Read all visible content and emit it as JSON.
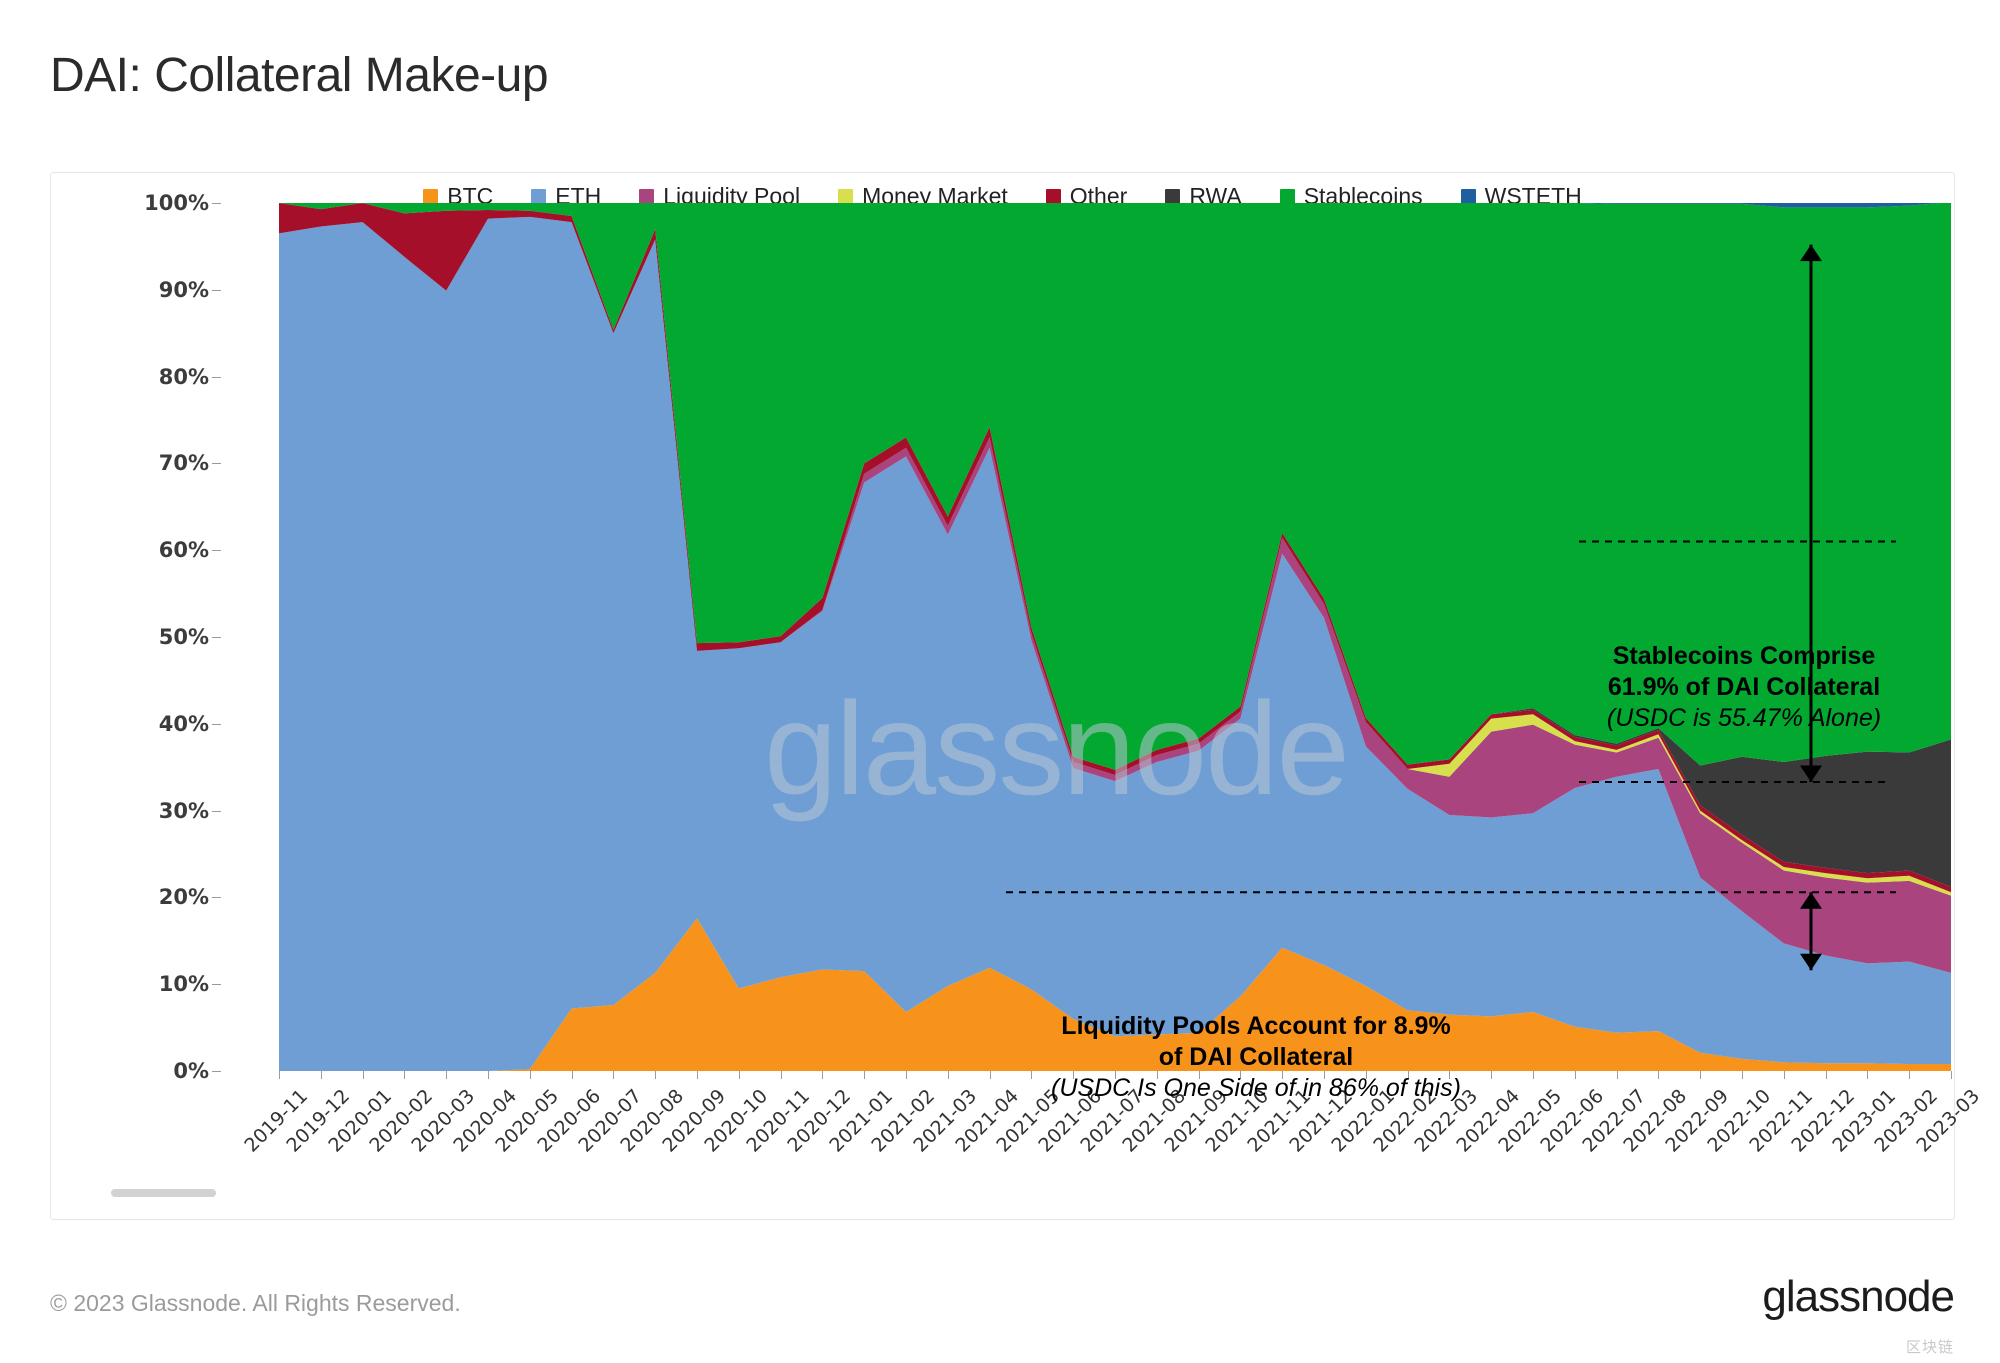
{
  "page_title": "DAI: Collateral Make-up",
  "footer": {
    "copyright": "© 2023 Glassnode. All Rights Reserved.",
    "logo": "glassnode",
    "corner_mark": "区块链"
  },
  "watermark": "glassnode",
  "annotations": {
    "stablecoins": {
      "line1": "Stablecoins Comprise",
      "line2": "61.9% of DAI Collateral",
      "line3": "(USDC is 55.47% Alone)"
    },
    "liquidity_pools": {
      "line1": "Liquidity Pools Account for 8.9%",
      "line2": "of DAI Collateral",
      "line3": "(USDC Is One Side of in 86% of this)"
    }
  },
  "chart_data": {
    "type": "area",
    "stacked": true,
    "title": "DAI: Collateral Make-up",
    "xlabel": "",
    "ylabel": "",
    "ylim": [
      0,
      100
    ],
    "ytick_labels": [
      "0%",
      "10%",
      "20%",
      "30%",
      "40%",
      "50%",
      "60%",
      "70%",
      "80%",
      "90%",
      "100%"
    ],
    "ytick_values": [
      0,
      10,
      20,
      30,
      40,
      50,
      60,
      70,
      80,
      90,
      100
    ],
    "grid": false,
    "legend_position": "top-center",
    "categories": [
      "2019-11",
      "2019-12",
      "2020-01",
      "2020-02",
      "2020-03",
      "2020-04",
      "2020-05",
      "2020-06",
      "2020-07",
      "2020-08",
      "2020-09",
      "2020-10",
      "2020-11",
      "2020-12",
      "2021-01",
      "2021-02",
      "2021-03",
      "2021-04",
      "2021-05",
      "2021-06",
      "2021-07",
      "2021-08",
      "2021-09",
      "2021-10",
      "2021-11",
      "2021-12",
      "2022-01",
      "2022-02",
      "2022-03",
      "2022-04",
      "2022-05",
      "2022-06",
      "2022-07",
      "2022-08",
      "2022-09",
      "2022-10",
      "2022-11",
      "2022-12",
      "2023-01",
      "2023-02",
      "2023-03"
    ],
    "series": [
      {
        "name": "BTC",
        "color": "#F7931A",
        "values": [
          0,
          0,
          0,
          0,
          0,
          0,
          0.2,
          7.2,
          7.6,
          11.3,
          17.6,
          9.5,
          10.8,
          11.7,
          11.5,
          6.8,
          9.8,
          11.9,
          9.4,
          6.0,
          4.0,
          4.2,
          4.4,
          8.6,
          14.2,
          12.2,
          9.8,
          7.0,
          6.5,
          6.3,
          6.8,
          5.1,
          4.4,
          4.6,
          2.1,
          1.4,
          1.0,
          0.9,
          0.9,
          0.8,
          0.8
        ]
      },
      {
        "name": "ETH",
        "color": "#6E9ED4",
        "values": [
          96.5,
          97.3,
          97.8,
          93.8,
          89.9,
          98.2,
          98.2,
          90.6,
          77.4,
          84.5,
          30.8,
          39.2,
          38.6,
          41.3,
          56.3,
          64.0,
          52.0,
          59.9,
          40.2,
          28.9,
          29.4,
          31.4,
          32.5,
          32.0,
          45.4,
          40.0,
          27.6,
          25.5,
          23.0,
          22.9,
          22.9,
          27.5,
          29.5,
          30.2,
          20.2,
          17.0,
          13.7,
          12.4,
          11.5,
          11.8,
          10.5
        ]
      },
      {
        "name": "Liquidity Pool",
        "color": "#A9447F",
        "values": [
          0,
          0,
          0,
          0,
          0,
          0,
          0,
          0,
          0,
          0,
          0,
          0,
          0,
          0.1,
          1.0,
          1.0,
          1.0,
          1.2,
          0.8,
          0.7,
          0.7,
          0.8,
          0.8,
          0.8,
          1.8,
          1.6,
          2.8,
          2.3,
          4.4,
          9.9,
          10.2,
          5.0,
          2.8,
          3.6,
          7.4,
          7.9,
          8.4,
          9.0,
          9.3,
          9.3,
          8.9
        ]
      },
      {
        "name": "Money Market",
        "color": "#D7E04C",
        "values": [
          0,
          0,
          0,
          0,
          0,
          0,
          0,
          0,
          0,
          0,
          0,
          0,
          0,
          0,
          0,
          0,
          0,
          0,
          0,
          0,
          0,
          0,
          0,
          0,
          0,
          0,
          0,
          0,
          1.5,
          1.5,
          1.2,
          0.4,
          0.3,
          0.4,
          0.3,
          0.3,
          0.4,
          0.5,
          0.5,
          0.6,
          0.4
        ]
      },
      {
        "name": "Other",
        "color": "#A50F2A",
        "values": [
          3.5,
          2.0,
          2.2,
          5.0,
          9.2,
          1.0,
          0.7,
          0.7,
          0.4,
          1.2,
          0.9,
          0.7,
          0.7,
          1.4,
          1.2,
          1.2,
          1.1,
          1.2,
          0.7,
          0.6,
          0.6,
          0.6,
          0.6,
          0.6,
          0.6,
          0.6,
          0.5,
          0.5,
          0.5,
          0.5,
          0.5,
          0.5,
          0.5,
          0.5,
          0.6,
          0.6,
          0.6,
          0.6,
          0.6,
          0.6,
          0.6
        ]
      },
      {
        "name": "RWA",
        "color": "#3A3A3A",
        "values": [
          0,
          0,
          0,
          0,
          0,
          0,
          0,
          0,
          0,
          0,
          0,
          0,
          0,
          0,
          0,
          0,
          0,
          0,
          0,
          0,
          0,
          0,
          0,
          0,
          0,
          0,
          0,
          0,
          0,
          0,
          0.2,
          0.2,
          0.2,
          0.2,
          4.6,
          9.0,
          11.5,
          12.9,
          14.0,
          13.6,
          17.0
        ]
      },
      {
        "name": "Stablecoins",
        "color": "#02A82F",
        "values": [
          0,
          0.7,
          0,
          1.2,
          0.9,
          0.8,
          0.9,
          1.5,
          14.6,
          3.0,
          50.7,
          50.6,
          49.9,
          45.5,
          30.0,
          27.0,
          36.1,
          25.8,
          48.9,
          63.8,
          65.3,
          63.0,
          61.7,
          58.0,
          38.0,
          45.6,
          59.3,
          64.7,
          64.1,
          58.9,
          58.2,
          61.3,
          62.2,
          60.4,
          64.7,
          63.7,
          63.9,
          63.2,
          62.7,
          63.0,
          61.9
        ]
      },
      {
        "name": "WSTETH",
        "color": "#1F5FA0",
        "values": [
          0,
          0,
          0,
          0,
          0,
          0,
          0,
          0,
          0,
          0,
          0,
          0,
          0,
          0,
          0,
          0,
          0,
          0,
          0,
          0,
          0,
          0,
          0,
          0,
          0,
          0,
          0,
          0,
          0,
          0,
          0,
          0,
          0.1,
          0.1,
          0.1,
          0.1,
          0.5,
          0.5,
          0.5,
          0.3,
          0.0
        ]
      }
    ]
  },
  "legend": [
    {
      "label": "BTC",
      "color": "#F7931A"
    },
    {
      "label": "ETH",
      "color": "#6E9ED4"
    },
    {
      "label": "Liquidity Pool",
      "color": "#A9447F"
    },
    {
      "label": "Money Market",
      "color": "#D7E04C"
    },
    {
      "label": "Other",
      "color": "#A50F2A"
    },
    {
      "label": "RWA",
      "color": "#3A3A3A"
    },
    {
      "label": "Stablecoins",
      "color": "#02A82F"
    },
    {
      "label": "WSTETH",
      "color": "#1F5FA0"
    }
  ]
}
